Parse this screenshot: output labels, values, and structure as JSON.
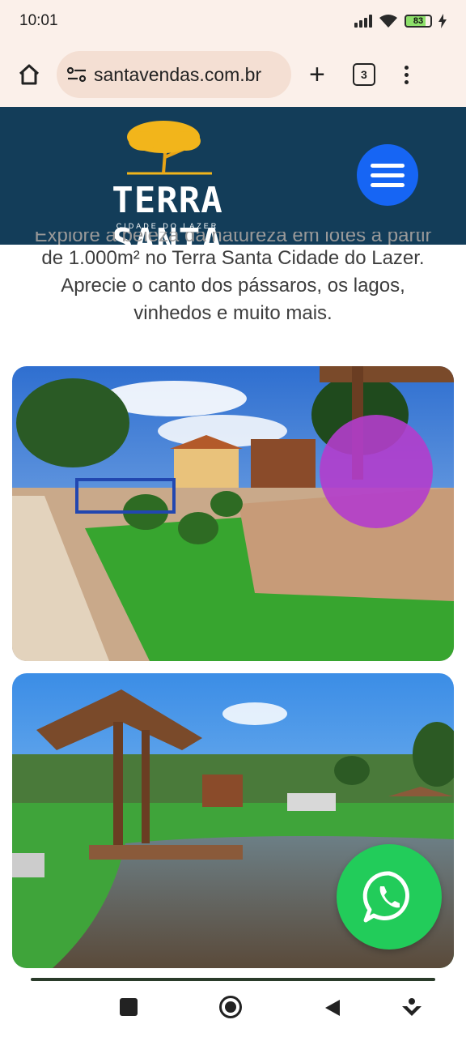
{
  "status_bar": {
    "time": "10:01",
    "battery": "83"
  },
  "browser": {
    "url": "santavendas.com.br",
    "tab_count": "3"
  },
  "site": {
    "logo_title": "TERRA SANTA",
    "logo_subtitle": "CIDADE DO LAZER",
    "brand_color": "#133d59",
    "menu_button_color": "#1665f4"
  },
  "intro": {
    "line0": "Explore a beleza da natureza em lotes a partir",
    "line1": "de 1.000m² no Terra Santa Cidade do Lazer.",
    "line2": "Aprecie o canto dos pássaros, os lagos,",
    "line3": "vinhedos e muito mais."
  },
  "whatsapp": {
    "color": "#22cc5a",
    "icon": "whatsapp-icon"
  }
}
